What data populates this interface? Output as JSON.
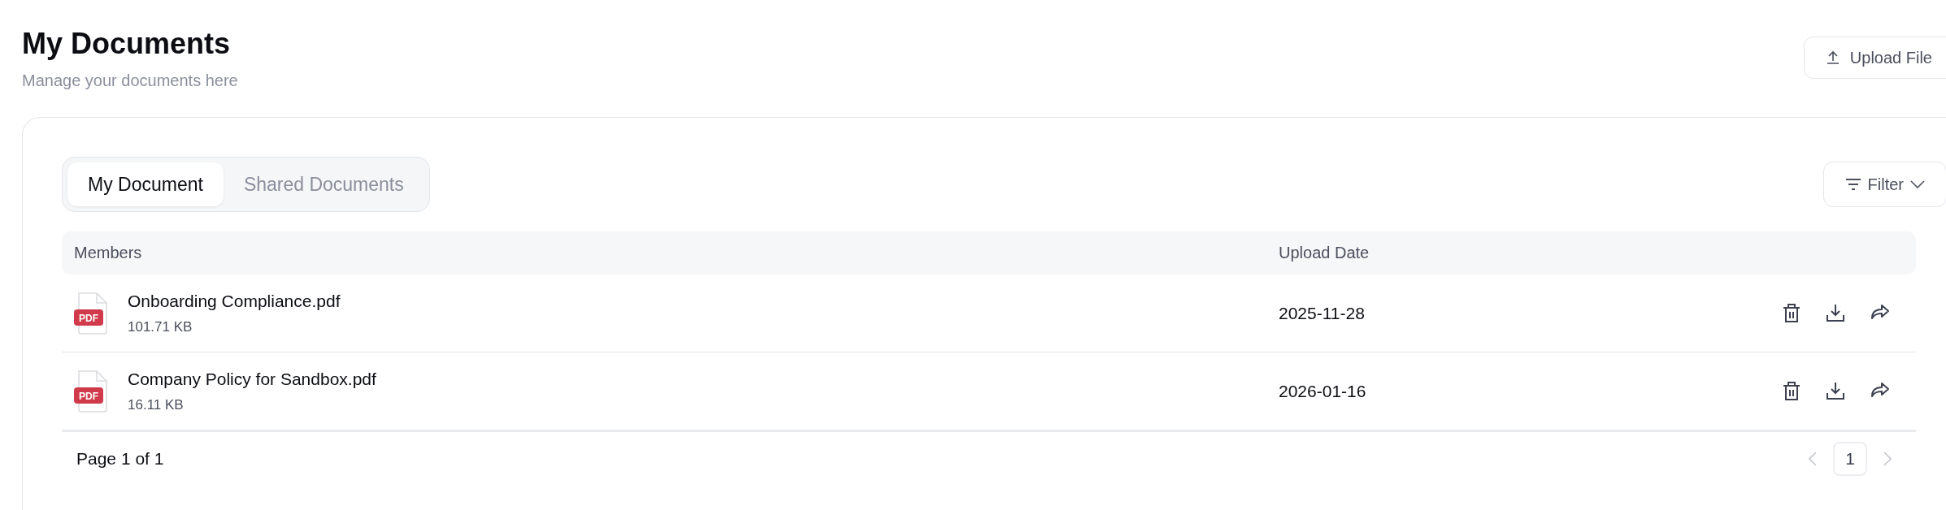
{
  "header": {
    "title": "My Documents",
    "subtitle": "Manage your documents here",
    "upload_button": "Upload File"
  },
  "tabs": [
    {
      "label": "My Document",
      "selected": true
    },
    {
      "label": "Shared Documents",
      "selected": false
    }
  ],
  "filter_button": "Filter",
  "table": {
    "columns": [
      "Members",
      "Upload Date"
    ],
    "rows": [
      {
        "file_type": "PDF",
        "name": "Onboarding Compliance.pdf",
        "size": "101.71 KB",
        "upload_date": "2025-11-28"
      },
      {
        "file_type": "PDF",
        "name": "Company Policy for Sandbox.pdf",
        "size": "16.11 KB",
        "upload_date": "2026-01-16"
      }
    ]
  },
  "pagination": {
    "summary": "Page 1 of 1",
    "pages": [
      {
        "label": "1",
        "selected": true
      }
    ],
    "prev_disabled": true,
    "next_disabled": true
  }
}
